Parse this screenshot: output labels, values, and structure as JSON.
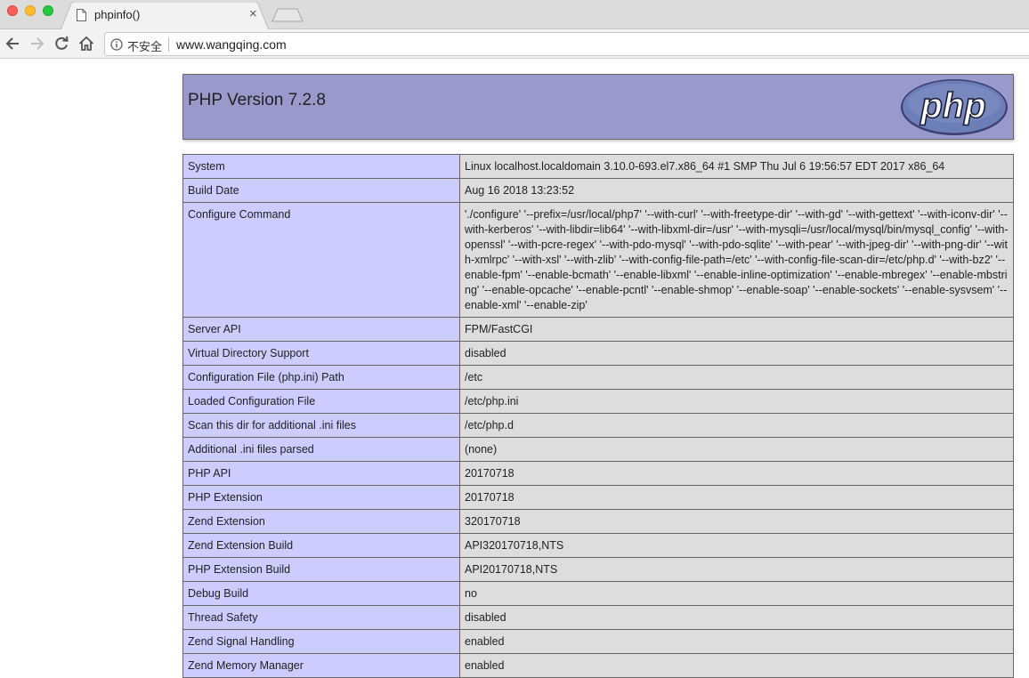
{
  "browser": {
    "tab_title": "phpinfo()",
    "tab_close_glyph": "×",
    "security_label": "不安全",
    "url": "www.wangqing.com"
  },
  "page": {
    "header_title": "PHP Version 7.2.8",
    "logo_text": "php",
    "rows": [
      {
        "label": "System",
        "value": "Linux localhost.localdomain 3.10.0-693.el7.x86_64 #1 SMP Thu Jul 6 19:56:57 EDT 2017 x86_64"
      },
      {
        "label": "Build Date",
        "value": "Aug 16 2018 13:23:52"
      },
      {
        "label": "Configure Command",
        "value": "'./configure' '--prefix=/usr/local/php7' '--with-curl' '--with-freetype-dir' '--with-gd' '--with-gettext' '--with-iconv-dir' '--with-kerberos' '--with-libdir=lib64' '--with-libxml-dir=/usr' '--with-mysqli=/usr/local/mysql/bin/mysql_config' '--with-openssl' '--with-pcre-regex' '--with-pdo-mysql' '--with-pdo-sqlite' '--with-pear' '--with-jpeg-dir' '--with-png-dir' '--with-xmlrpc' '--with-xsl' '--with-zlib' '--with-config-file-path=/etc' '--with-config-file-scan-dir=/etc/php.d' '--with-bz2' '--enable-fpm' '--enable-bcmath' '--enable-libxml' '--enable-inline-optimization' '--enable-mbregex' '--enable-mbstring' '--enable-opcache' '--enable-pcntl' '--enable-shmop' '--enable-soap' '--enable-sockets' '--enable-sysvsem' '--enable-xml' '--enable-zip'"
      },
      {
        "label": "Server API",
        "value": "FPM/FastCGI"
      },
      {
        "label": "Virtual Directory Support",
        "value": "disabled"
      },
      {
        "label": "Configuration File (php.ini) Path",
        "value": "/etc"
      },
      {
        "label": "Loaded Configuration File",
        "value": "/etc/php.ini"
      },
      {
        "label": "Scan this dir for additional .ini files",
        "value": "/etc/php.d"
      },
      {
        "label": "Additional .ini files parsed",
        "value": "(none)"
      },
      {
        "label": "PHP API",
        "value": "20170718"
      },
      {
        "label": "PHP Extension",
        "value": "20170718"
      },
      {
        "label": "Zend Extension",
        "value": "320170718"
      },
      {
        "label": "Zend Extension Build",
        "value": "API320170718,NTS"
      },
      {
        "label": "PHP Extension Build",
        "value": "API20170718,NTS"
      },
      {
        "label": "Debug Build",
        "value": "no"
      },
      {
        "label": "Thread Safety",
        "value": "disabled"
      },
      {
        "label": "Zend Signal Handling",
        "value": "enabled"
      },
      {
        "label": "Zend Memory Manager",
        "value": "enabled"
      }
    ]
  },
  "colors": {
    "header_bg": "#9999cc",
    "label_cell_bg": "#ccccff",
    "value_cell_bg": "#dddddd",
    "logo_bg": "#6c7eb7"
  },
  "icons": [
    "page-icon",
    "close-icon",
    "back-arrow-icon",
    "forward-arrow-icon",
    "reload-icon",
    "home-icon",
    "info-icon",
    "php-logo"
  ]
}
